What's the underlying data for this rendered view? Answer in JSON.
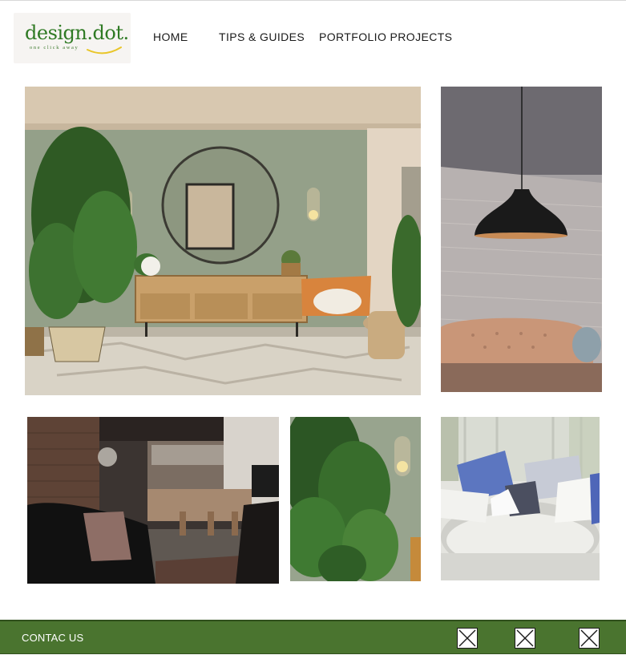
{
  "brand": {
    "name": "design.dot.",
    "tagline": "one click away",
    "color": "#2f7a24"
  },
  "nav": {
    "items": [
      "HOME",
      "TIPS & GUIDES",
      "PORTFOLIO PROJECTS"
    ]
  },
  "gallery": {
    "images": [
      "living-room-green-wall",
      "black-pendant-lamp",
      "industrial-loft-interior",
      "tropical-plant-with-sconce",
      "round-white-sofa-cushions"
    ]
  },
  "footer": {
    "contact_label": "CONTAC US",
    "accent": "#4a742f",
    "social_icons": [
      "broken-image-icon",
      "broken-image-icon",
      "broken-image-icon"
    ]
  }
}
